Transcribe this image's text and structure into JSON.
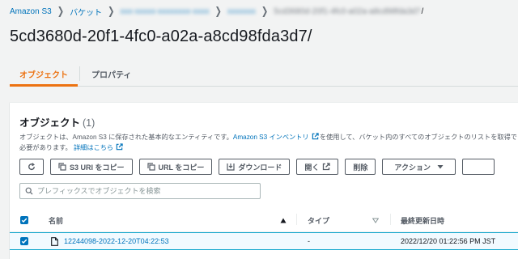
{
  "breadcrumb": {
    "items": [
      {
        "label": "Amazon S3",
        "link": true,
        "redacted": false
      },
      {
        "label": "バケット",
        "link": true,
        "redacted": false
      },
      {
        "label": "xxx-xxxxx-xxxxxxxx-xxxx",
        "link": true,
        "redacted": true
      },
      {
        "label": "xxxxxxx",
        "link": true,
        "redacted": true
      },
      {
        "label": "5cd3680d-20f1-4fc0-a02a-a8cd98fda3d7",
        "link": false,
        "redacted": true
      }
    ],
    "trailing_slash": "/"
  },
  "page": {
    "title": "5cd3680d-20f1-4fc0-a02a-a8cd98fda3d7/"
  },
  "tabs": [
    {
      "label": "オブジェクト",
      "active": true
    },
    {
      "label": "プロパティ",
      "active": false
    }
  ],
  "objects_panel": {
    "title": "オブジェクト",
    "count": "(1)",
    "description": {
      "part1": "オブジェクトは、Amazon S3 に保存された基本的なエンティティです。",
      "inventory_link": "Amazon S3 インベントリ",
      "part2": "を使用して、バケット内のすべてのオブジェクトのリストを取得できま",
      "part3": "必要があります。",
      "details_link": "詳細はこちら"
    },
    "toolbar": {
      "copy_s3_uri": "S3 URI をコピー",
      "copy_url": "URL をコピー",
      "download": "ダウンロード",
      "open": "開く",
      "delete": "削除",
      "actions": "アクション"
    },
    "search": {
      "placeholder": "プレフィックスでオブジェクトを検索",
      "value": ""
    },
    "table": {
      "columns": {
        "name": "名前",
        "type": "タイプ",
        "last_modified": "最終更新日時"
      },
      "rows": [
        {
          "name": "12244098-2022-12-20T04:22:53",
          "type": "-",
          "last_modified": "2022/12/20 01:22:56 PM JST",
          "selected": true
        }
      ]
    }
  },
  "colors": {
    "link": "#0073bb",
    "accent": "#ec7211",
    "selected_row": "#f1faff",
    "selected_border": "#00a1c9"
  }
}
